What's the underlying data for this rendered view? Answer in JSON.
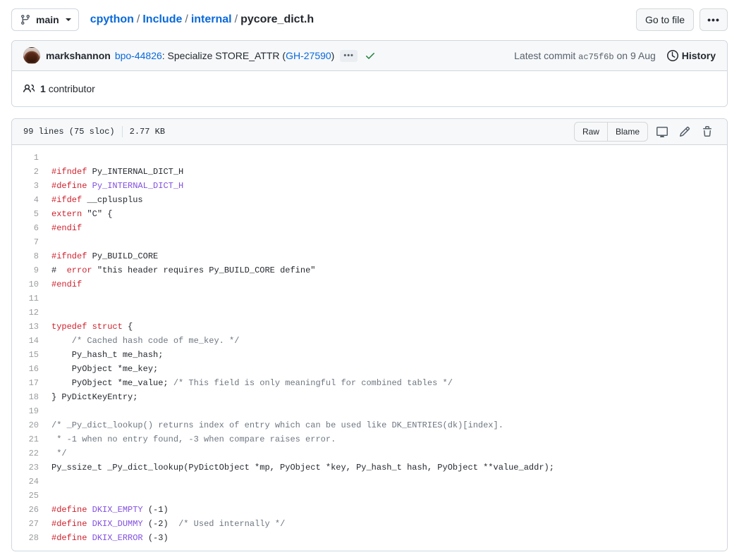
{
  "topbar": {
    "branch": {
      "label": "main",
      "icon": "git-branch-icon"
    },
    "breadcrumb": {
      "parts": [
        "cpython",
        "Include",
        "internal"
      ],
      "separator": "/",
      "current": "pycore_dict.h"
    },
    "go_to_file_label": "Go to file",
    "kebab_label": "•••"
  },
  "commit": {
    "author": "markshannon",
    "message_prefix": "bpo-44826",
    "message_rest": ": Specialize STORE_ATTR (",
    "message_link": "GH-27590",
    "message_suffix": ")",
    "expand_label": "•••",
    "status_icon": "check-icon",
    "latest_commit_label": "Latest commit",
    "sha": "ac75f6b",
    "date": "on 9 Aug",
    "history_label": "History",
    "history_icon": "clock-icon",
    "contributors_icon": "people-icon",
    "contributors_count": "1",
    "contributors_label": "contributor"
  },
  "file": {
    "lines_label": "99 lines (75 sloc)",
    "size_label": "2.77 KB",
    "raw_label": "Raw",
    "blame_label": "Blame",
    "icons": [
      "desktop-icon",
      "pencil-icon",
      "trash-icon"
    ],
    "first_line_number": 1,
    "code": [
      [],
      [
        [
          "pp",
          "#ifndef"
        ],
        [
          "txt",
          " Py_INTERNAL_DICT_H"
        ]
      ],
      [
        [
          "pp",
          "#define"
        ],
        [
          "mac",
          " Py_INTERNAL_DICT_H"
        ]
      ],
      [
        [
          "pp",
          "#ifdef"
        ],
        [
          "txt",
          " __cplusplus"
        ]
      ],
      [
        [
          "kw",
          "extern"
        ],
        [
          "str",
          " \"C\" {"
        ]
      ],
      [
        [
          "pp",
          "#endif"
        ]
      ],
      [],
      [
        [
          "pp",
          "#ifndef"
        ],
        [
          "txt",
          " Py_BUILD_CORE"
        ]
      ],
      [
        [
          "txt",
          "#  "
        ],
        [
          "pp",
          "error"
        ],
        [
          "txt",
          " \"this header requires Py_BUILD_CORE define\""
        ]
      ],
      [
        [
          "pp",
          "#endif"
        ]
      ],
      [],
      [],
      [
        [
          "kw",
          "typedef struct"
        ],
        [
          "txt",
          " {"
        ]
      ],
      [
        [
          "com",
          "    /* Cached hash code of me_key. */"
        ]
      ],
      [
        [
          "txt",
          "    Py_hash_t me_hash;"
        ]
      ],
      [
        [
          "txt",
          "    PyObject *me_key;"
        ]
      ],
      [
        [
          "txt",
          "    PyObject *me_value; "
        ],
        [
          "com",
          "/* This field is only meaningful for combined tables */"
        ]
      ],
      [
        [
          "txt",
          "} PyDictKeyEntry;"
        ]
      ],
      [],
      [
        [
          "com",
          "/* _Py_dict_lookup() returns index of entry which can be used like DK_ENTRIES(dk)[index]."
        ]
      ],
      [
        [
          "com",
          " * -1 when no entry found, -3 when compare raises error."
        ]
      ],
      [
        [
          "com",
          " */"
        ]
      ],
      [
        [
          "txt",
          "Py_ssize_t _Py_dict_lookup(PyDictObject *mp, PyObject *key, Py_hash_t hash, PyObject **value_addr);"
        ]
      ],
      [],
      [],
      [
        [
          "pp",
          "#define"
        ],
        [
          "mac",
          " DKIX_EMPTY"
        ],
        [
          "txt",
          " (-1)"
        ]
      ],
      [
        [
          "pp",
          "#define"
        ],
        [
          "mac",
          " DKIX_DUMMY"
        ],
        [
          "txt",
          " (-2)  "
        ],
        [
          "com",
          "/* Used internally */"
        ]
      ],
      [
        [
          "pp",
          "#define"
        ],
        [
          "mac",
          " DKIX_ERROR"
        ],
        [
          "txt",
          " (-3)"
        ]
      ]
    ]
  },
  "colors": {
    "link": "#0969da",
    "border": "#d0d7de",
    "header_bg": "#f6f8fa",
    "text": "#24292f",
    "muted": "#57606a",
    "preprocessor": "#cf222e",
    "macro": "#8250df",
    "comment": "#6e7781",
    "success": "#1a7f37"
  }
}
